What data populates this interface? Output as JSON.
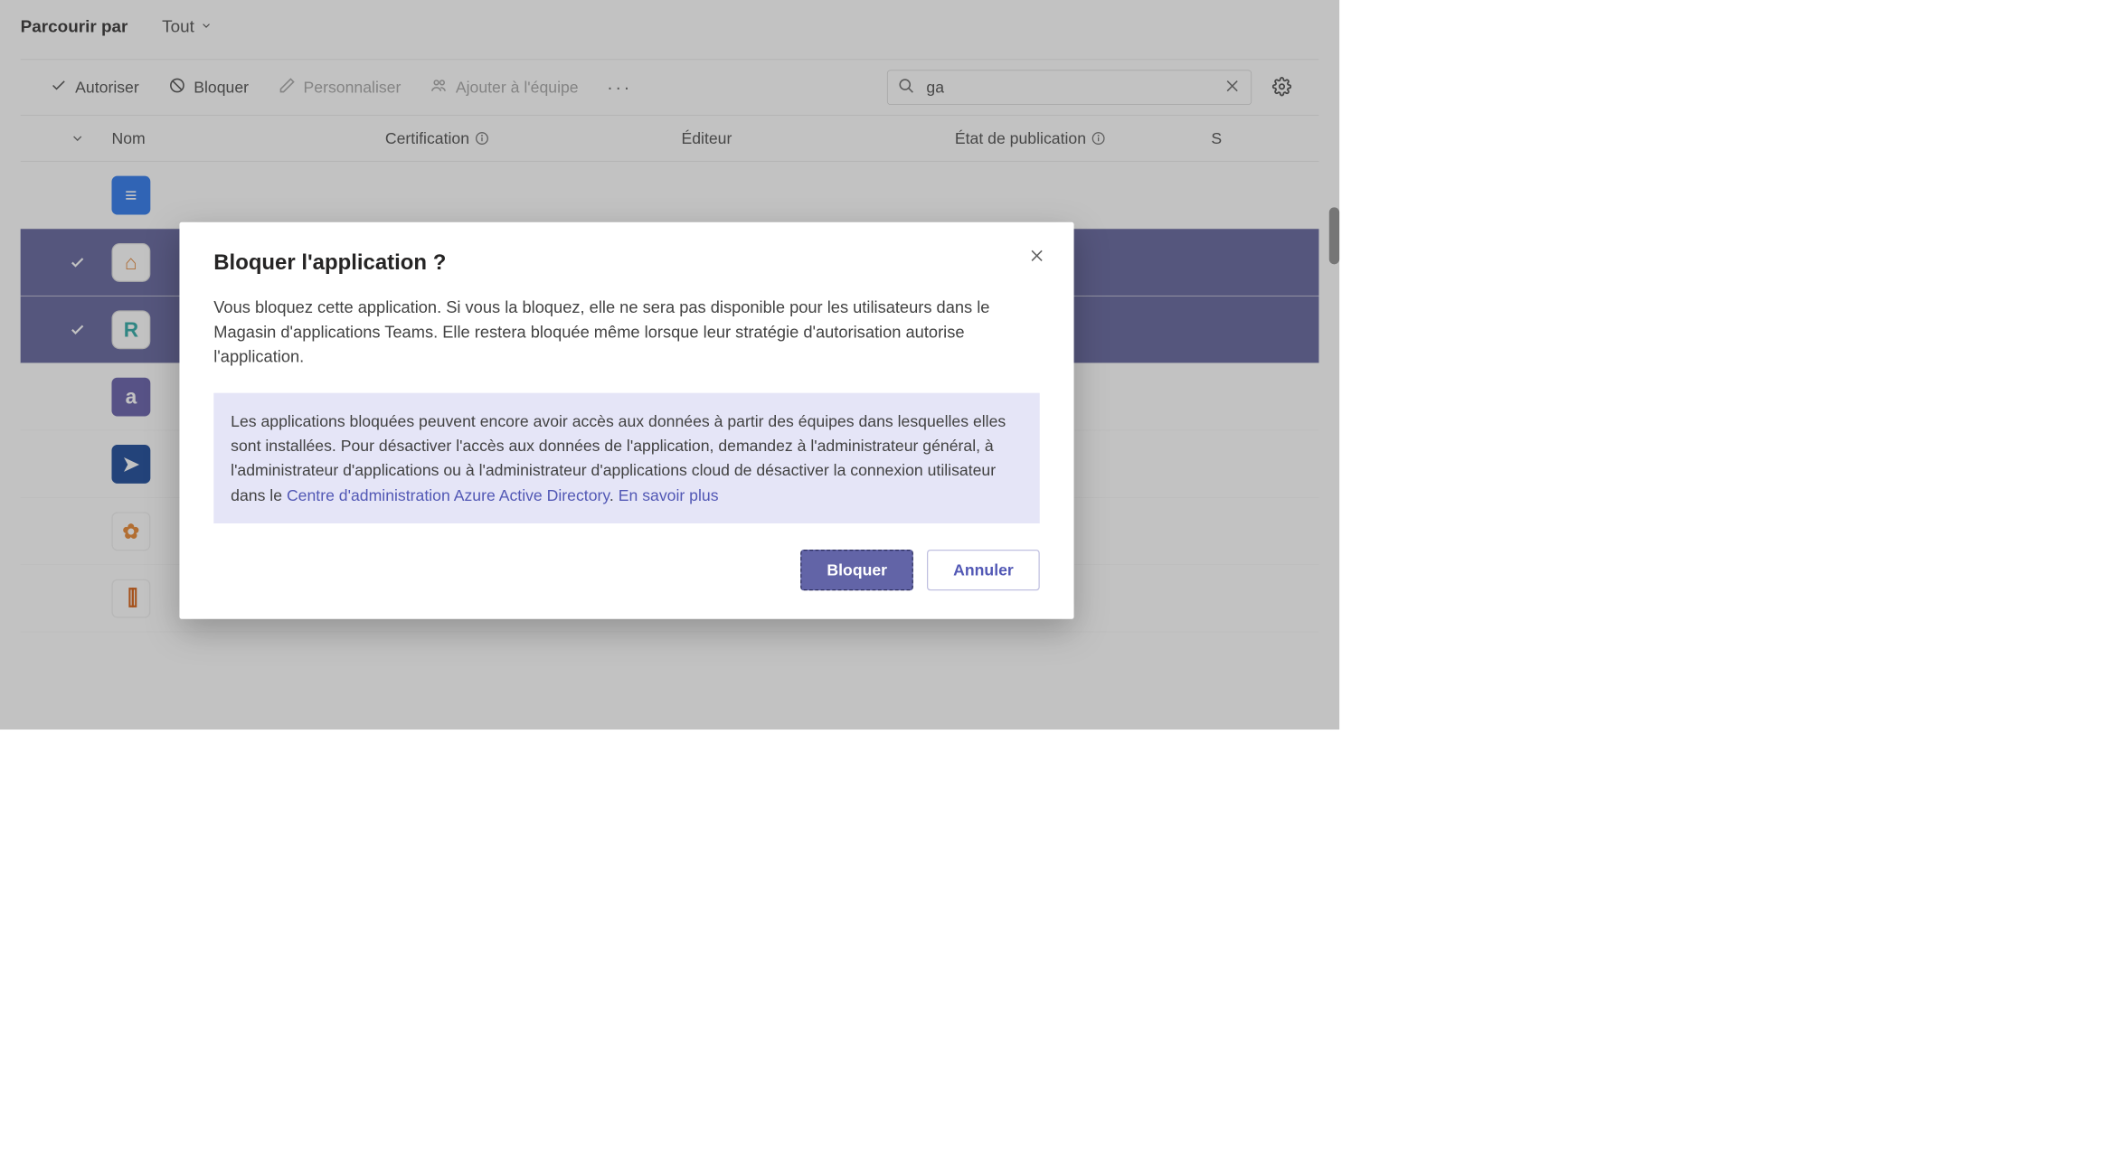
{
  "header": {
    "browse_label": "Parcourir par",
    "filter_value": "Tout"
  },
  "toolbar": {
    "authorize": "Autoriser",
    "block": "Bloquer",
    "customize": "Personnaliser",
    "add_to_team": "Ajouter à l'équipe"
  },
  "search": {
    "value": "ga"
  },
  "columns": {
    "name": "Nom",
    "certification": "Certification",
    "publisher": "Éditeur",
    "publish_state": "État de publication",
    "s": "S"
  },
  "rows": [
    {
      "icon_letter": "≡",
      "icon_class": "blue",
      "selected": false
    },
    {
      "icon_letter": "⌂",
      "icon_class": "light",
      "selected": true
    },
    {
      "icon_letter": "R",
      "icon_class": "teal",
      "selected": true
    },
    {
      "icon_letter": "a",
      "icon_class": "purple",
      "selected": false
    },
    {
      "icon_letter": "➤",
      "icon_class": "darkblue",
      "selected": false
    },
    {
      "icon_letter": "✿",
      "icon_class": "white",
      "selected": false
    },
    {
      "icon_letter": "⫿⫿",
      "icon_class": "orange-map",
      "selected": false
    }
  ],
  "modal": {
    "title": "Bloquer l'application ?",
    "body": "Vous bloquez cette application. Si vous la bloquez, elle ne sera pas disponible pour les utilisateurs dans le Magasin d'applications Teams. Elle restera bloquée même lorsque leur stratégie d'autorisation autorise l'application.",
    "info_text": "Les applications bloquées peuvent encore avoir accès aux données à partir des équipes dans lesquelles elles sont installées. Pour désactiver l'accès aux données de l'application, demandez à l'administrateur général, à l'administrateur d'applications ou à l'administrateur d'applications cloud de désactiver la connexion utilisateur dans le ",
    "info_link1": "Centre d'administration Azure Active Directory",
    "info_sep": ". ",
    "info_link2": "En savoir plus",
    "btn_block": "Bloquer",
    "btn_cancel": "Annuler"
  }
}
